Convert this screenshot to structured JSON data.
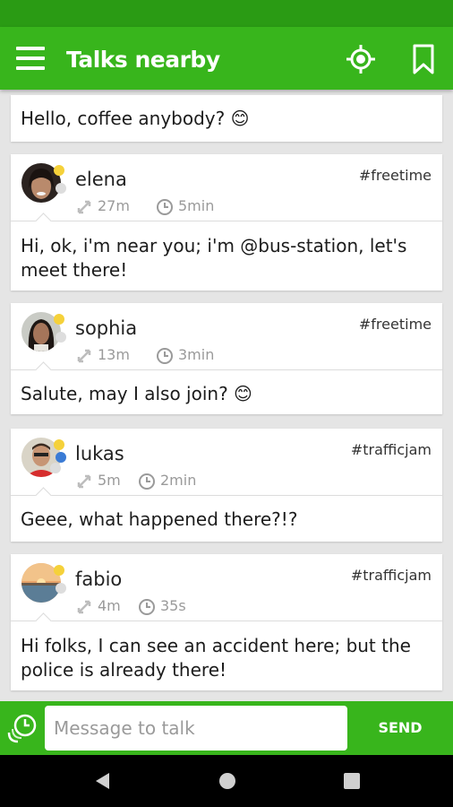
{
  "app": {
    "title": "Talks nearby",
    "accent_color": "#38b51c",
    "status_color": "#2a9b14"
  },
  "header": {
    "menu_icon": "hamburger-menu-icon",
    "locate_icon": "crosshair-location-icon",
    "bookmark_icon": "bookmark-icon"
  },
  "feed": {
    "top_partial_message": "Hello, coffee anybody? 😊",
    "posts": [
      {
        "name": "elena",
        "tag": "#freetime",
        "distance": "27m",
        "time": "5min",
        "message": "Hi, ok, i'm near you; i'm @bus-station, let's meet there!"
      },
      {
        "name": "sophia",
        "tag": "#freetime",
        "distance": "13m",
        "time": "3min",
        "message": "Salute, may I also join? 😊"
      },
      {
        "name": "lukas",
        "tag": "#trafficjam",
        "distance": "5m",
        "time": "2min",
        "message": "Geee, what happened there?!?"
      },
      {
        "name": "fabio",
        "tag": "#trafficjam",
        "distance": "4m",
        "time": "35s",
        "message": "Hi folks, I can see an accident here; but the police is already there!"
      }
    ]
  },
  "composer": {
    "placeholder": "Message to talk",
    "send_label": "SEND"
  }
}
